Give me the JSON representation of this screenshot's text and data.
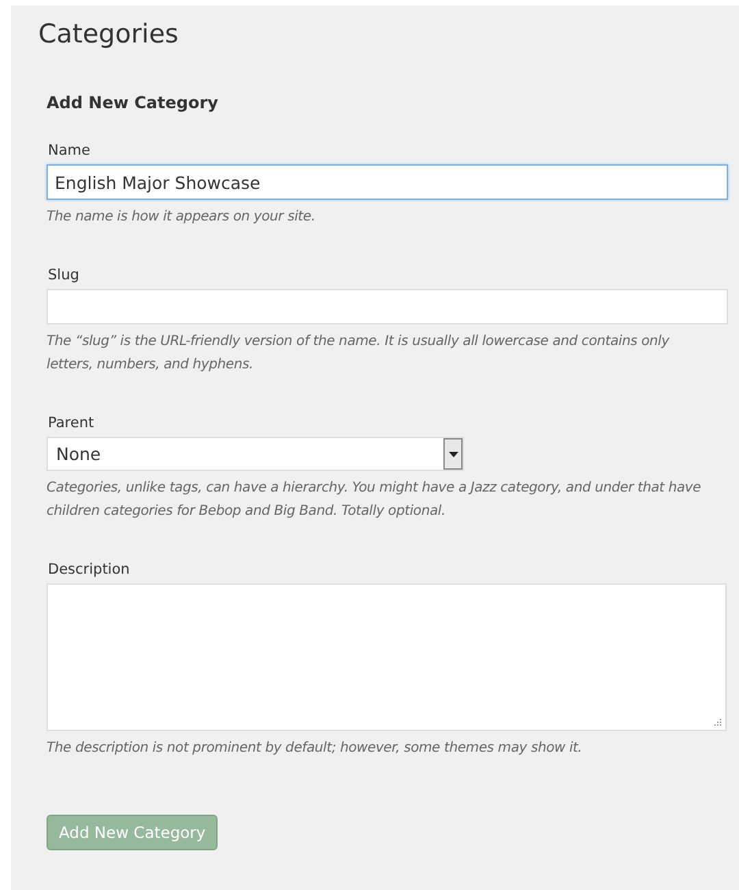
{
  "page": {
    "title": "Categories"
  },
  "form": {
    "heading": "Add New Category",
    "fields": [
      {
        "kind": "text",
        "label": "Name",
        "value": "English Major Showcase",
        "focused": true,
        "hint": "The name is how it appears on your site."
      },
      {
        "kind": "text",
        "label": "Slug",
        "focused": false,
        "hint": "The “slug” is the URL-friendly version of the name. It is usually all lowercase and contains only letters, numbers, and hyphens."
      },
      {
        "kind": "select",
        "label": "Parent",
        "value": "None",
        "hint": "Categories, unlike tags, can have a hierarchy. You might have a Jazz category, and under that have children categories for Bebop and Big Band. Totally optional."
      },
      {
        "kind": "textarea",
        "label": "Description",
        "hint": "The description is not prominent by default; however, some themes may show it."
      }
    ],
    "submit": {
      "label": "Add New Category",
      "disabled": true
    }
  }
}
